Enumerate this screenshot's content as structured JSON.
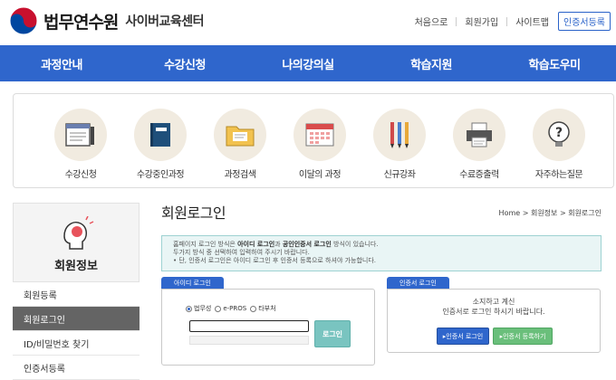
{
  "header": {
    "logo_main": "법무연수원",
    "logo_sub": "사이버교육센터",
    "util": [
      "처음으로",
      "회원가입",
      "사이트맵"
    ],
    "cert_register": "인증서등록"
  },
  "nav": [
    "과정안내",
    "수강신청",
    "나의강의실",
    "학습지원",
    "학습도우미"
  ],
  "quick": [
    {
      "label": "수강신청",
      "icon": "application-form-icon"
    },
    {
      "label": "수강중인과정",
      "icon": "book-icon"
    },
    {
      "label": "과정검색",
      "icon": "folder-search-icon"
    },
    {
      "label": "이달의 과정",
      "icon": "calendar-icon"
    },
    {
      "label": "신규강좌",
      "icon": "pencils-icon"
    },
    {
      "label": "수료증출력",
      "icon": "printer-icon"
    },
    {
      "label": "자주하는질문",
      "icon": "question-bulb-icon"
    }
  ],
  "sidebar": {
    "title": "회원정보",
    "items": [
      "회원등록",
      "회원로그인",
      "ID/비밀번호 찾기",
      "인증서등록"
    ],
    "active_index": 1
  },
  "main": {
    "title": "회원로그인",
    "breadcrumb": "Home > 회원정보 > 회원로그인",
    "notice": {
      "l1a": "홈페이지 로그인 방식은 ",
      "l1b": "아이디 로그인",
      "l1c": "과 ",
      "l1d": "공인인증서 로그인",
      "l1e": " 방식이 있습니다.",
      "line2": "두가지 방식 중 선택하여 입력하여 주시기 바랍니다.",
      "line3": "• 단, 인증서 로그인은 아이디 로그인 후 인증서 등록으로 하셔야 가능합니다."
    },
    "id_login": {
      "tab": "아이디 로그인",
      "radios": [
        "법무성",
        "e-PROS",
        "타부처"
      ],
      "login_button": "로그인"
    },
    "cert_login": {
      "tab": "인증서 로그인",
      "msg1": "소지하고 계신",
      "msg2": "인증서로 로그인 하시기 바랍니다.",
      "btn_login": "▸인증서 로그인",
      "btn_register": "▸인증서 등록하기"
    }
  },
  "colors": {
    "primary": "#2f66cc",
    "teal": "#79c4c0",
    "green": "#6abf7b"
  }
}
